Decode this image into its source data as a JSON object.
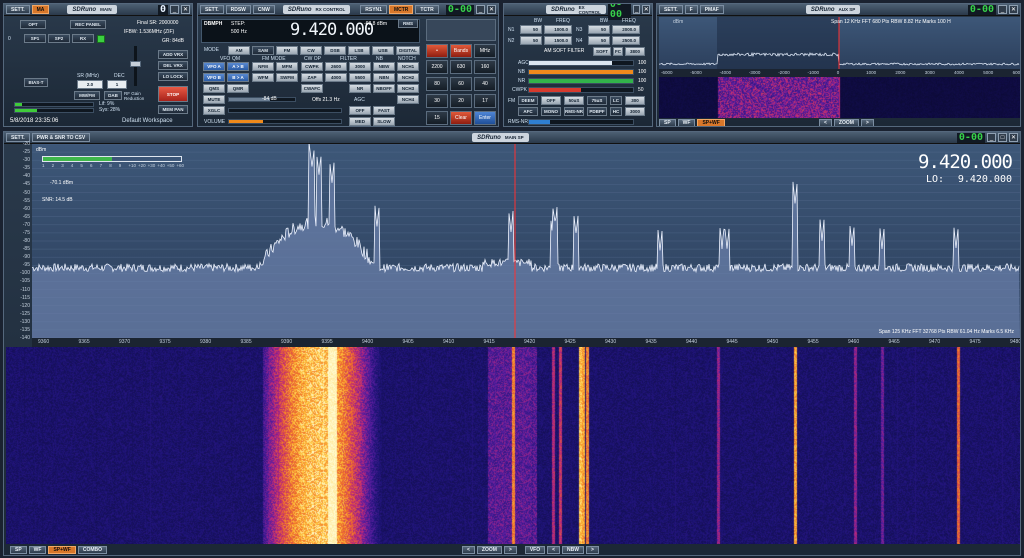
{
  "main": {
    "sett": "SETT.",
    "ma": "MA",
    "logo": "SDRuno",
    "title": "MAIN",
    "opt": "OPT",
    "rec": "REC PANEL",
    "zero": "0",
    "sp1": "SP1",
    "sp2": "SP2",
    "rx": "RX",
    "final_sr": "Final SR: 2000000",
    "ifbw": "IFBW: 1.536MHz (ZIF)",
    "gr": "GR: 84dB",
    "add_vrx": "ADD VRX",
    "del_vrx": "DEL VRX",
    "lo_lock": "LO LOCK",
    "bias": "BIAS-T",
    "sr_label": "SR (MHz)",
    "dec_label": "DEC",
    "sr_val": "2.0",
    "dec_val": "1",
    "mwfm": "MW/FM",
    "dab": "DAB",
    "rf_gain": "RF Gain Reduction",
    "stop": "STOP",
    "lif": "Lif: 9%",
    "sys": "Sys: 28%",
    "mem": "MEM PAN",
    "datetime": "5/8/2018 23:35:06",
    "workspace": "Default Workspace",
    "seg": "0"
  },
  "rx": {
    "sett": "SETT.",
    "rdsw": "RDSW",
    "cnw": "CNW",
    "logo": "SDRuno",
    "title": "RX CONTROL",
    "rsyn": "RSYN1",
    "mctr": "MCTR",
    "tctr": "TCTR",
    "dbmph": "DBMPH",
    "step_lbl": "STEP:",
    "step": "500 Hz",
    "freq": "9.420.000",
    "level": "-68.8 dBm",
    "rms": "RMS",
    "mode_lbl": "MODE",
    "modes": [
      "AM",
      "SAM",
      "FM",
      "CW",
      "DSB",
      "LSB",
      "USB",
      "DIGITAL"
    ],
    "vfo_lbl": "VFO",
    "qm_lbl": "QM",
    "fm_mode_lbl": "FM MODE",
    "cw_op_lbl": "CW OP",
    "filter_lbl": "FILTER",
    "nb_lbl": "NB",
    "notch_lbl": "NOTCH",
    "vfoa": "VFO A",
    "ab": "A > B",
    "nfm": "NFM",
    "mfm": "MFM",
    "cwpk": "CWPK",
    "f2600": "2600",
    "f3000": "3000",
    "nbw": "NBW",
    "nch1": "NCH1",
    "vfob": "VFO B",
    "ba": "B > A",
    "wfm": "WFM",
    "swfm": "SWFM",
    "zap": "ZAP",
    "f4000": "4000",
    "f5500": "5500",
    "nbn": "NBN",
    "nch2": "NCH2",
    "qms": "QMS",
    "qmr": "QMR",
    "cwafc": "CWAFC",
    "nr": "NR",
    "nboff": "NBOFF",
    "nch3": "NCH3",
    "mute": "MUTE",
    "squelch": "-84 dB",
    "offs": "Offs 21.3 Hz",
    "agc_lbl": "AGC",
    "nch4": "NCH4",
    "xglc": "XGLC",
    "agc_off": "OFF",
    "fast": "FAST",
    "volume": "VOLUME",
    "med": "MED",
    "slow": "SLOW",
    "pad": {
      "bands": "Bands",
      "mhz": "MHz",
      "keys": [
        "2200",
        "630",
        "160",
        "80",
        "60",
        "40",
        "30",
        "20",
        "17",
        "15"
      ],
      "clear": "Clear",
      "enter": "Enter"
    },
    "seg": "0-00"
  },
  "ex": {
    "logo": "SDRuno",
    "title": "EX CONTROL",
    "seg": "0-00",
    "bw": "BW",
    "freq": "FREQ",
    "n1": "N1",
    "n2": "N2",
    "n3": "N3",
    "n4": "N4",
    "n1bw": "50",
    "n1f": "1000.0",
    "n2bw": "50",
    "n2f": "1500.0",
    "n3bw": "50",
    "n3f": "2000.0",
    "n4bw": "50",
    "n4f": "2500.0",
    "am_soft": "AM SOFT FILTER",
    "soft": "SOFT",
    "fc": "FC",
    "fc_val": "3800",
    "agc": "AGC",
    "agc_v": "100",
    "nb": "NB",
    "nb_v": "100",
    "nr": "NR",
    "nr_v": "100",
    "cwpk": "CWPK",
    "cwpk_v": "50",
    "fm_lbl": "FM",
    "deem": "DEEM",
    "off": "OFF",
    "s50": "50uS",
    "s75": "75uS",
    "lc": "LC",
    "lc_v": "300",
    "afc": "AFC",
    "mono": "MONO",
    "rmsnr": "RMS-NR",
    "pdbpf": "PDBPF",
    "hc": "HC",
    "hc_v": "3000",
    "rmsnr_lbl": "RMS-NR"
  },
  "aux": {
    "sett": "SETT.",
    "f": "F",
    "pmaf": "PMAF",
    "logo": "SDRuno",
    "title": "AUX SP",
    "seg": "0-00",
    "info": "Span 12 KHz   FFT 680 Pts   RBW 8.82 Hz   Marks 100 H",
    "dbm": "dBm",
    "xticks": [
      "-6000",
      "-5000",
      "-4000",
      "-3000",
      "-2000",
      "-1000",
      "0",
      "1000",
      "2000",
      "3000",
      "4000",
      "5000",
      "6000"
    ],
    "sp": "SP",
    "wf": "WF",
    "spwf": "SP+WF",
    "zoom": "ZOOM"
  },
  "sp": {
    "sett": "SETT.",
    "pwr": "PWR & SNR TO CSV",
    "logo": "SDRuno",
    "title": "MAIN SP",
    "seg": "0-00",
    "dbm": "dBm",
    "smeter": [
      "1",
      "2",
      "3",
      "4",
      "5",
      "6",
      "7",
      "8",
      "9",
      "+10",
      "+20",
      "+30",
      "+40",
      "+50",
      "+60"
    ],
    "level": "-70.1 dBm",
    "snr": "SNR: 14.5 dB",
    "freq": "9.420.000",
    "lo_lbl": "LO:",
    "lo": "9.420.000",
    "info": "Span 125 KHz   FFT 32768 Pts   RBW 61.04 Hz   Marks 6.5 KHz",
    "yticks": [
      "-20",
      "-25",
      "-30",
      "-35",
      "-40",
      "-45",
      "-50",
      "-55",
      "-60",
      "-65",
      "-70",
      "-75",
      "-80",
      "-85",
      "-90",
      "-95",
      "-100",
      "-105",
      "-110",
      "-115",
      "-120",
      "-125",
      "-130",
      "-135",
      "-140"
    ],
    "xticks": [
      "9360",
      "9365",
      "9370",
      "9375",
      "9380",
      "9385",
      "9390",
      "9395",
      "9400",
      "9405",
      "9410",
      "9415",
      "9420",
      "9425",
      "9430",
      "9435",
      "9440",
      "9445",
      "9450",
      "9455",
      "9460",
      "9465",
      "9470",
      "9475",
      "9480"
    ],
    "sp": "SP",
    "wf": "WF",
    "spwf": "SP+WF",
    "combo": "COMBO",
    "zoom": "ZOOM",
    "vfo": "VFO",
    "nbw": "NBW"
  },
  "colors": {
    "accent": "#d8772a",
    "panel": "#2a3a4c",
    "spectrum": "#5a6f9a",
    "marker": "#ff3030"
  },
  "icons": {
    "close": "close-icon",
    "min": "minimize-icon",
    "max": "maximize-icon",
    "arrow_left": "arrow-left-icon",
    "arrow_right": "arrow-right-icon"
  }
}
